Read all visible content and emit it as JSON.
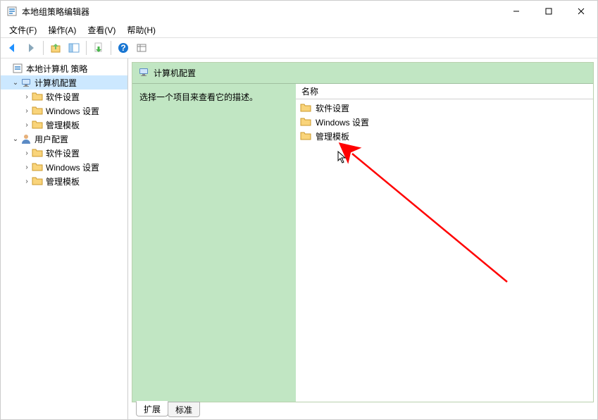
{
  "window": {
    "title": "本地组策略编辑器"
  },
  "menu": {
    "file": "文件(F)",
    "action": "操作(A)",
    "view": "查看(V)",
    "help": "帮助(H)"
  },
  "tree": {
    "root": "本地计算机 策略",
    "computer_config": "计算机配置",
    "computer_children": {
      "software": "软件设置",
      "windows": "Windows 设置",
      "admin": "管理模板"
    },
    "user_config": "用户配置",
    "user_children": {
      "software": "软件设置",
      "windows": "Windows 设置",
      "admin": "管理模板"
    }
  },
  "content": {
    "header": "计算机配置",
    "description": "选择一个项目来查看它的描述。",
    "column_name": "名称",
    "items": {
      "software": "软件设置",
      "windows": "Windows 设置",
      "admin": "管理模板"
    }
  },
  "tabs": {
    "extended": "扩展",
    "standard": "标准"
  }
}
